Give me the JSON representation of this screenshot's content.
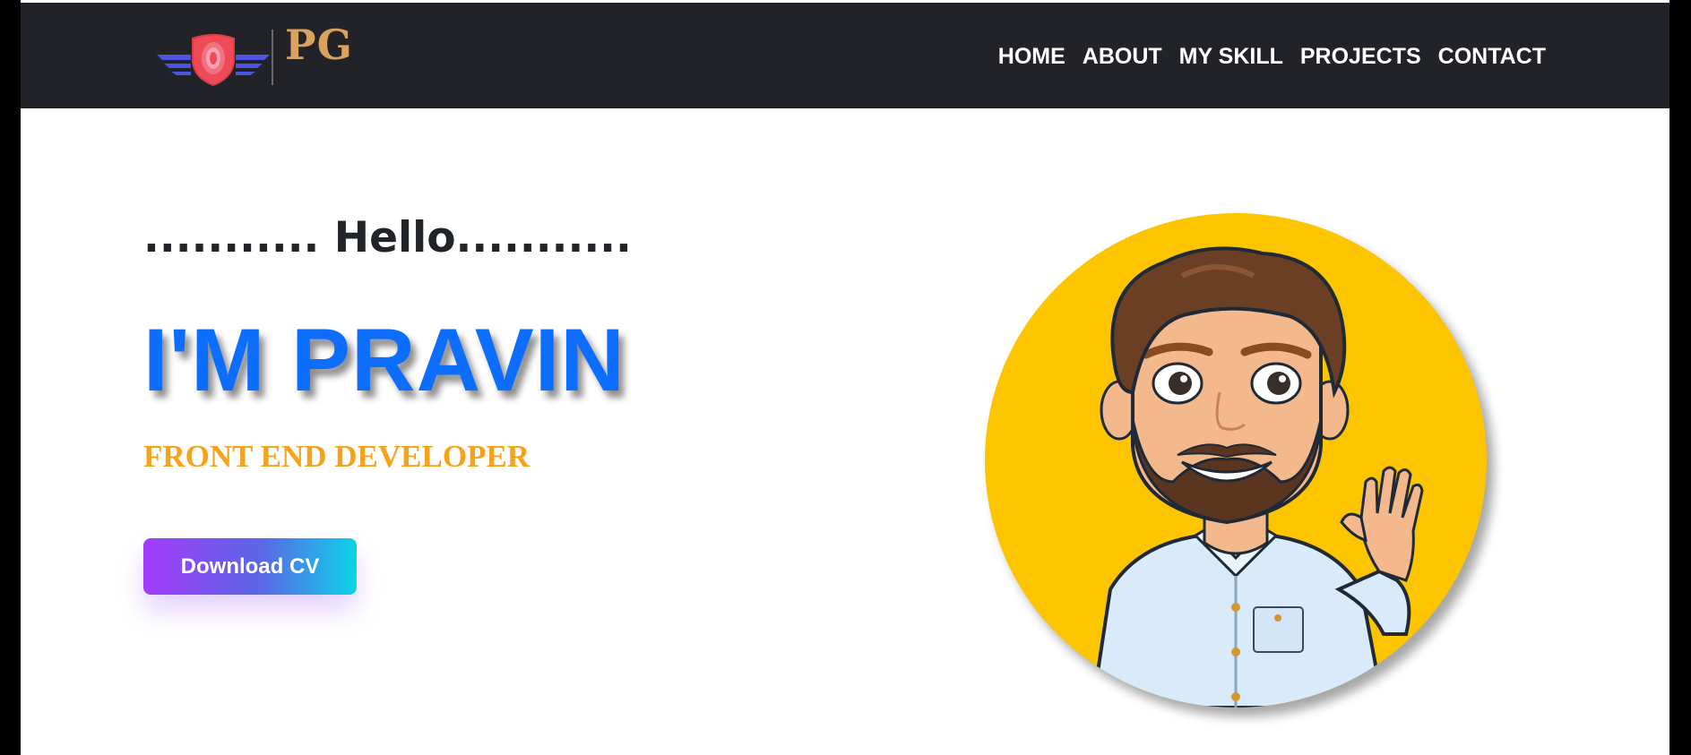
{
  "brand": {
    "logo_text": "PG",
    "logo_icon": "winged-shield-icon"
  },
  "nav": {
    "items": [
      {
        "label": "HOME"
      },
      {
        "label": "ABOUT"
      },
      {
        "label": "MY SKILL"
      },
      {
        "label": "PROJECTS"
      },
      {
        "label": "CONTACT"
      }
    ]
  },
  "hero": {
    "greeting": "........... Hello...........",
    "name": "I'M PRAVIN",
    "role": "FRONT END DEVELOPER",
    "cta_label": "Download CV",
    "avatar_icon": "cartoon-avatar-icon"
  },
  "colors": {
    "navbar_bg": "#212329",
    "name_blue": "#0d6efd",
    "role_orange": "#f7a21b",
    "avatar_bg": "#fdc400",
    "logo_gold": "#d9a25f"
  }
}
